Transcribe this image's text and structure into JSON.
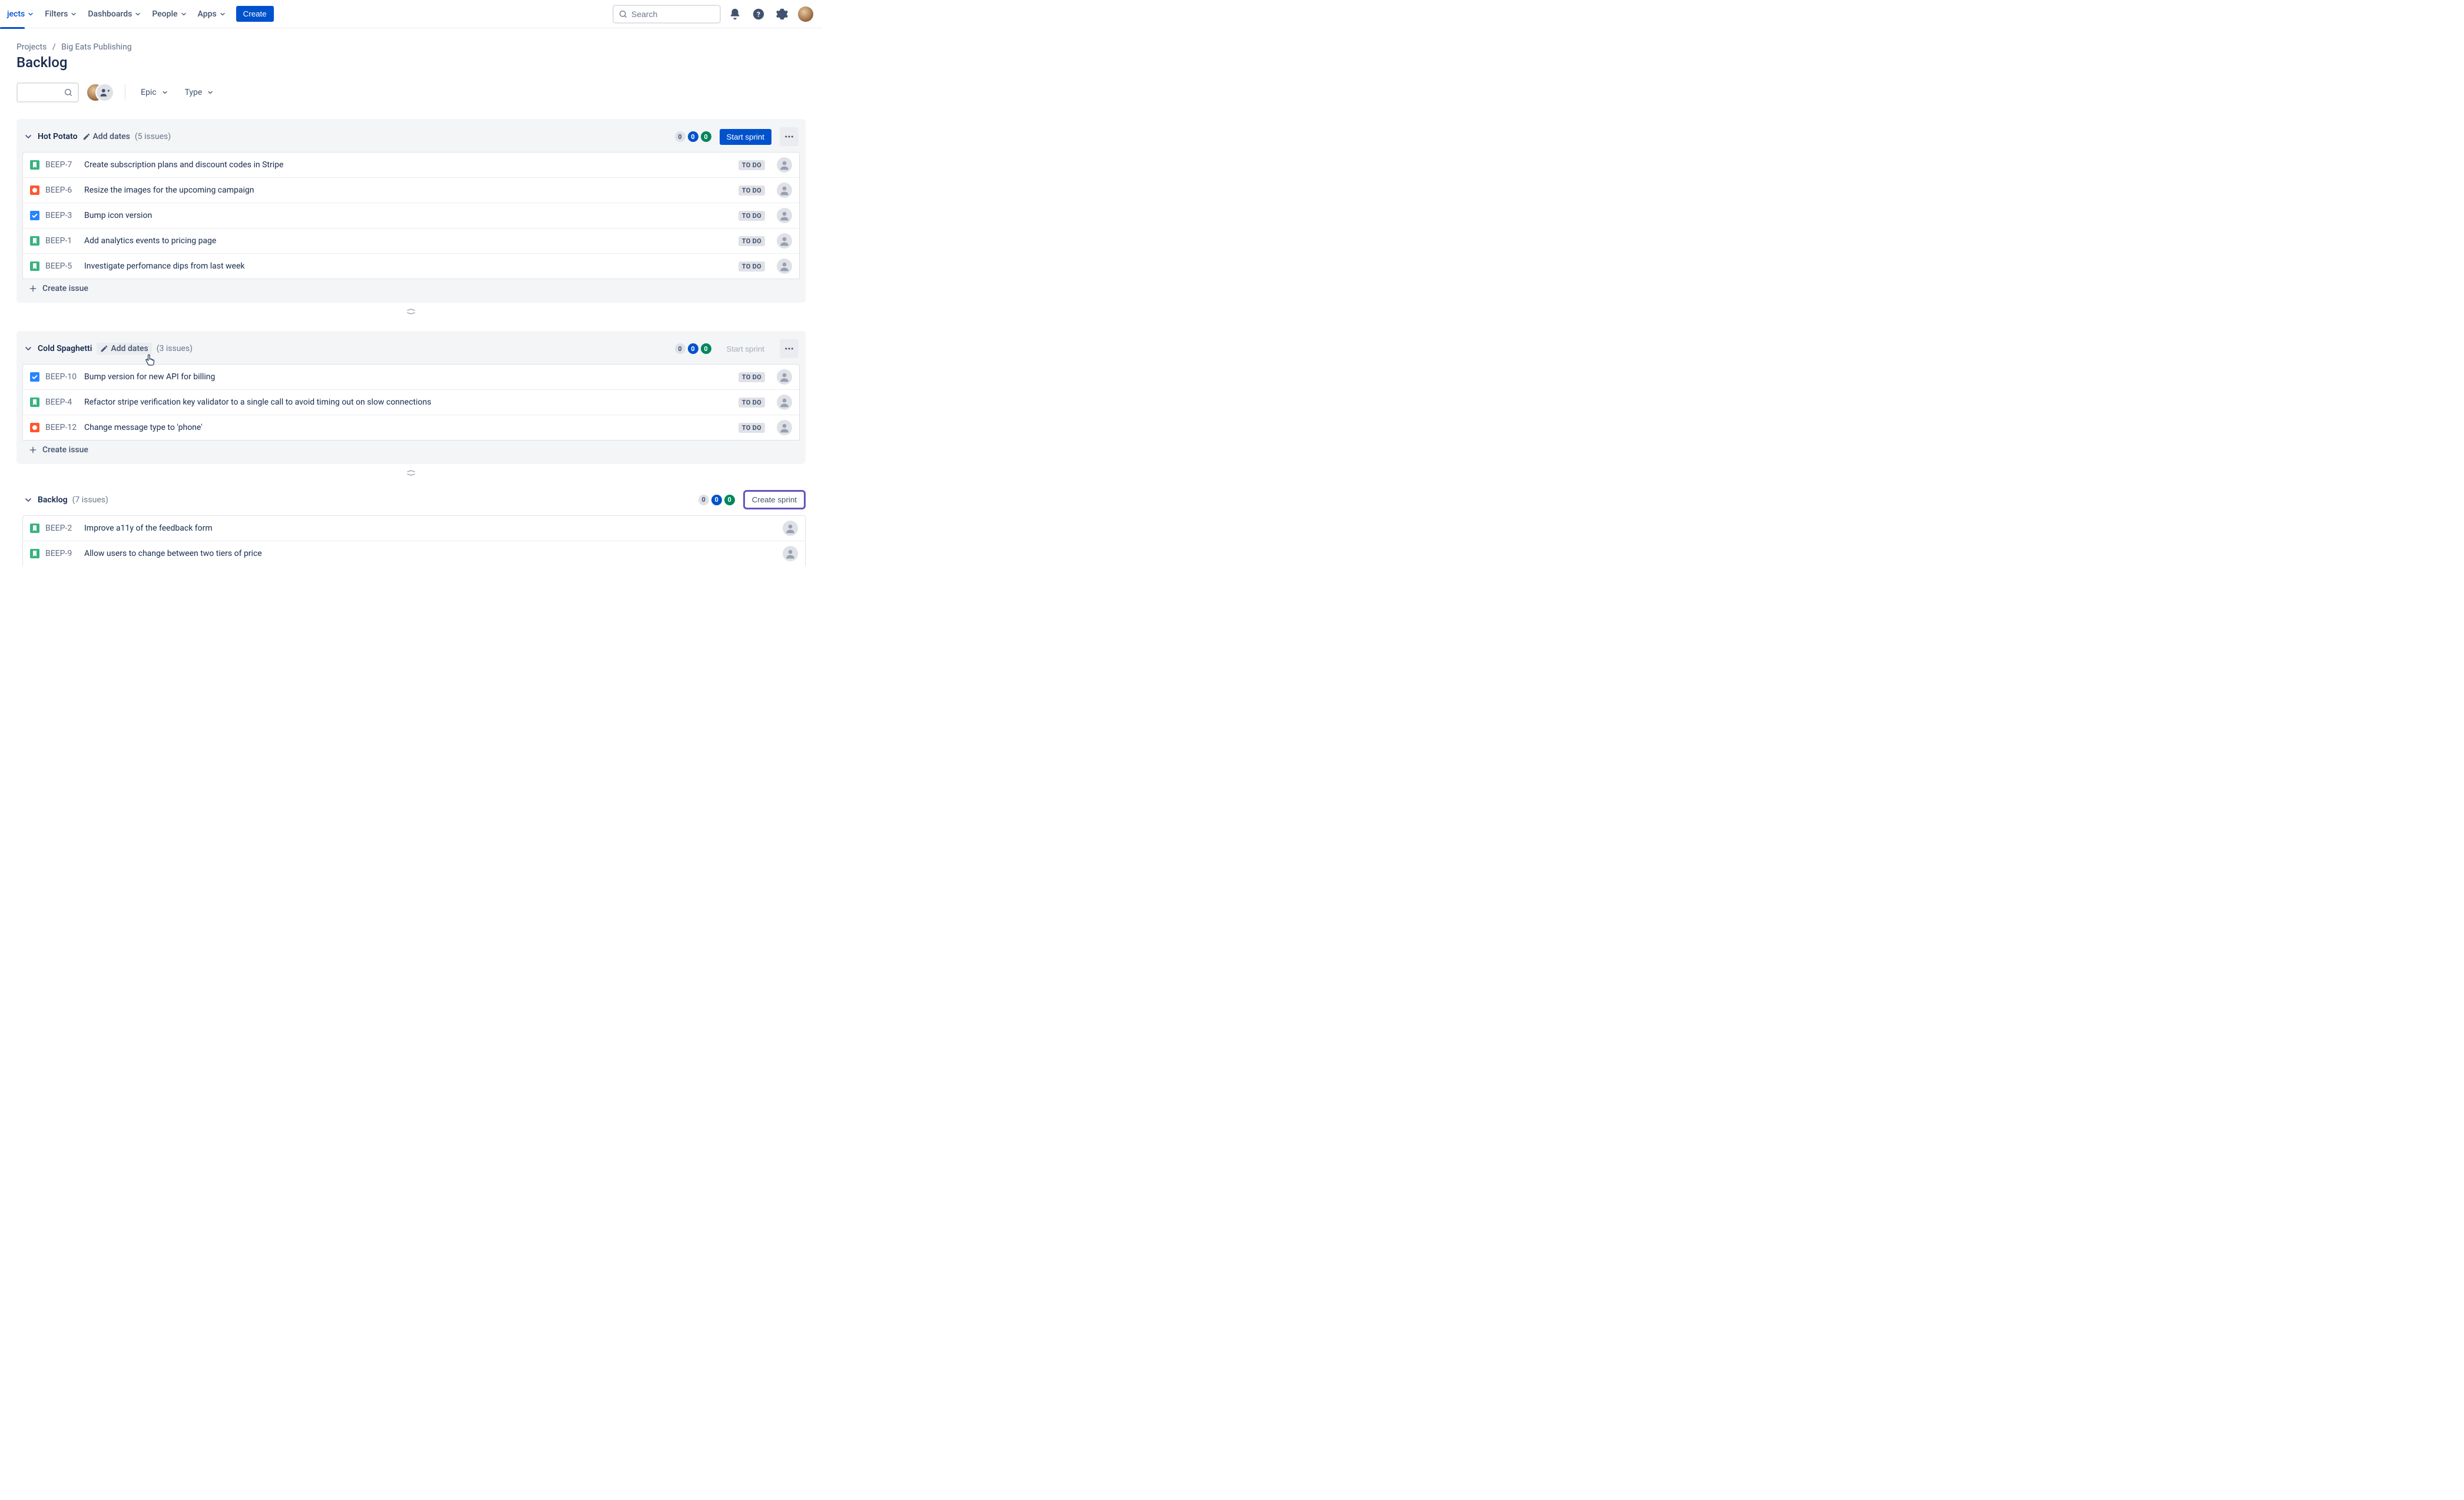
{
  "nav": {
    "items": [
      {
        "label": "jects",
        "selected": true
      },
      {
        "label": "Filters"
      },
      {
        "label": "Dashboards"
      },
      {
        "label": "People"
      },
      {
        "label": "Apps"
      }
    ],
    "create": "Create",
    "search_placeholder": "Search"
  },
  "breadcrumb": {
    "root": "Projects",
    "project": "Big Eats Publishing"
  },
  "page_title": "Backlog",
  "filters": {
    "epic": "Epic",
    "type": "Type"
  },
  "sections": [
    {
      "name": "Hot Potato",
      "add_dates": "Add dates",
      "count_label": "(5 issues)",
      "badges": [
        "0",
        "0",
        "0"
      ],
      "action": "Start sprint",
      "action_enabled": true,
      "add_dates_hover": false,
      "issues": [
        {
          "type": "story",
          "key": "BEEP-7",
          "summary": "Create subscription plans and discount codes in Stripe",
          "status": "TO DO"
        },
        {
          "type": "bug",
          "key": "BEEP-6",
          "summary": "Resize the images for the upcoming campaign",
          "status": "TO DO"
        },
        {
          "type": "task",
          "key": "BEEP-3",
          "summary": "Bump icon version",
          "status": "TO DO"
        },
        {
          "type": "story",
          "key": "BEEP-1",
          "summary": "Add analytics events to pricing page",
          "status": "TO DO"
        },
        {
          "type": "story",
          "key": "BEEP-5",
          "summary": "Investigate perfomance dips from last week",
          "status": "TO DO"
        }
      ],
      "create_issue": "Create issue"
    },
    {
      "name": "Cold Spaghetti",
      "add_dates": "Add dates",
      "count_label": "(3 issues)",
      "badges": [
        "0",
        "0",
        "0"
      ],
      "action": "Start sprint",
      "action_enabled": false,
      "add_dates_hover": true,
      "issues": [
        {
          "type": "task",
          "key": "BEEP-10",
          "summary": "Bump version for new API for billing",
          "status": "TO DO"
        },
        {
          "type": "story",
          "key": "BEEP-4",
          "summary": "Refactor stripe verification key validator to a single call to avoid timing out on slow connections",
          "status": "TO DO"
        },
        {
          "type": "bug",
          "key": "BEEP-12",
          "summary": "Change message type to 'phone'",
          "status": "TO DO"
        }
      ],
      "create_issue": "Create issue"
    }
  ],
  "backlog": {
    "name": "Backlog",
    "count_label": "(7 issues)",
    "badges": [
      "0",
      "0",
      "0"
    ],
    "action": "Create sprint",
    "issues": [
      {
        "type": "story",
        "key": "BEEP-2",
        "summary": "Improve a11y of the feedback form"
      },
      {
        "type": "story",
        "key": "BEEP-9",
        "summary": "Allow users to change between two tiers of price"
      }
    ]
  }
}
